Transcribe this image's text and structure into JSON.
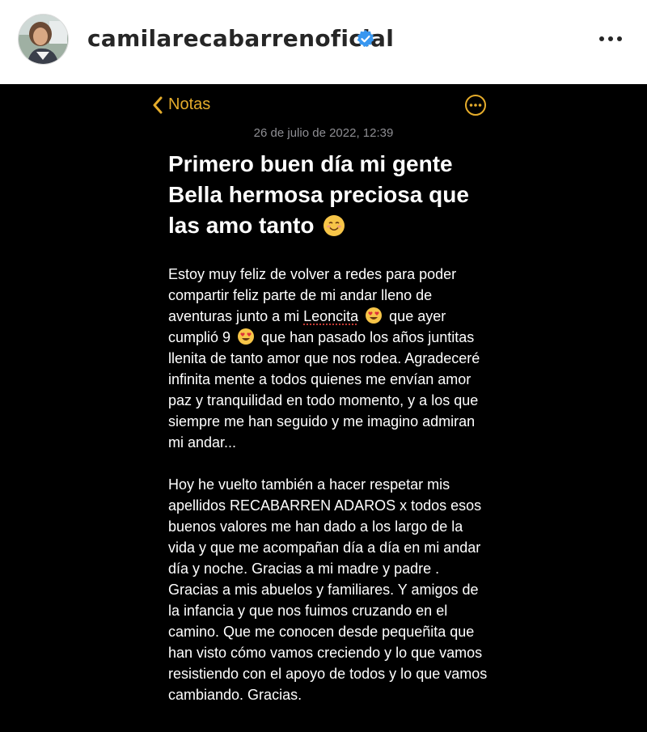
{
  "post_header": {
    "username": "camilarecabarrenoficial",
    "verified": true,
    "avatar_icon": "profile-photo",
    "more_icon": "more-horizontal-icon"
  },
  "notes_app": {
    "back_label": "Notas",
    "accent_color": "#e5ac2b",
    "date": "26 de julio de 2022, 12:39",
    "title_line1": "Primero buen día mi gente",
    "title_line2": "Bella hermosa preciosa que",
    "title_line3": "las amo tanto",
    "body": {
      "p1_a": "Estoy muy feliz de volver a redes para poder compartir feliz parte de mi andar lleno de aventuras junto a mi ",
      "p1_name": "Leoncita",
      "p1_b": " que ayer cumplió 9 ",
      "p1_c": " que han pasado los años juntitas llenita de tanto amor que nos rodea. Agradeceré infinita mente a todos quienes me envían amor paz y tranquilidad en todo momento, y a los que siempre me han seguido y me imagino admiran mi andar...",
      "p2": "Hoy he vuelto también a hacer respetar mis apellidos RECABARREN ADAROS x todos esos buenos valores me han dado a los largo de la vida y que me acompañan día a día en mi andar día y noche. Gracias a mi madre y padre . Gracias a mis abuelos y familiares. Y amigos de la infancia y que nos fuimos cruzando en el camino. Que me conocen desde pequeñita que han visto cómo vamos creciendo y lo que vamos resistiendo con el apoyo de todos y lo que vamos cambiando. Gracias."
    }
  }
}
